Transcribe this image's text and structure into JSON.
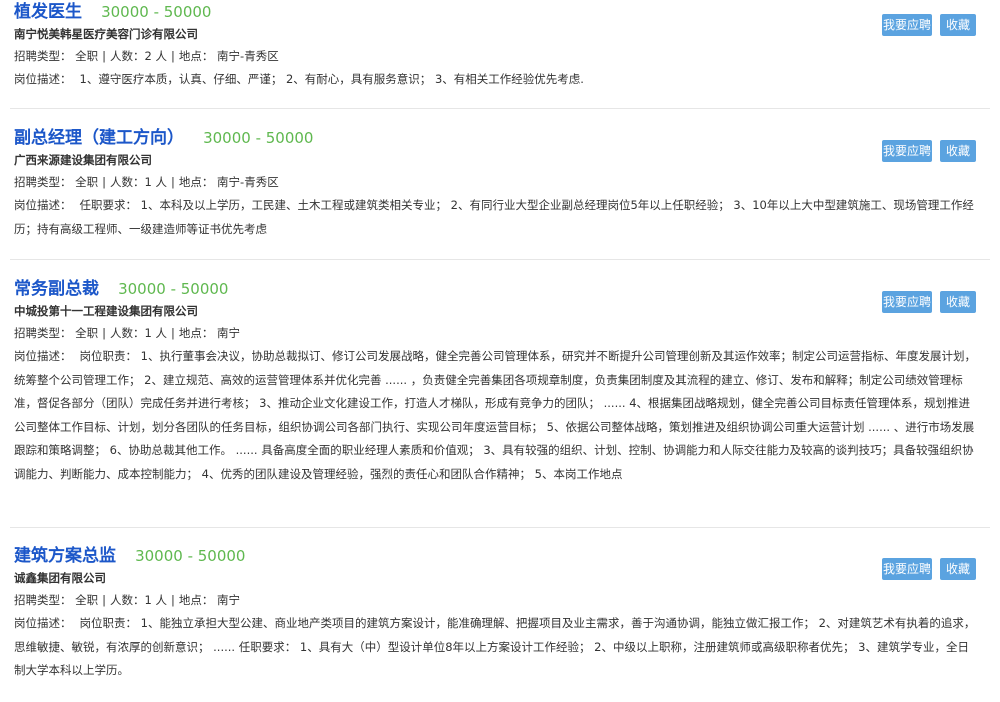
{
  "labels": {
    "type": "招聘类型：",
    "count": "人数：",
    "location": "地点：",
    "description": "岗位描述：",
    "apply_button": "我要应聘",
    "favorite_button": "收藏"
  },
  "jobs": [
    {
      "title": "植发医生",
      "salary": "30000 - 50000",
      "company": "南宁悦美韩星医疗美容门诊有限公司",
      "type": "全职",
      "count": "2 人",
      "location": "南宁-青秀区",
      "description": "1、遵守医疗本质，认真、仔细、严谨； 2、有耐心，具有服务意识； 3、有相关工作经验优先考虑."
    },
    {
      "title": "副总经理（建工方向）",
      "salary": "30000 - 50000",
      "company": "广西来源建设集团有限公司",
      "type": "全职",
      "count": "1 人",
      "location": "南宁-青秀区",
      "description": "任职要求： 1、本科及以上学历，工民建、土木工程或建筑类相关专业； 2、有同行业大型企业副总经理岗位5年以上任职经验； 3、10年以上大中型建筑施工、现场管理工作经历；持有高级工程师、一级建造师等证书优先考虑"
    },
    {
      "title": "常务副总裁",
      "salary": "30000 - 50000",
      "company": "中城投第十一工程建设集团有限公司",
      "type": "全职",
      "count": "1 人",
      "location": "南宁",
      "description": "岗位职责： 1、执行董事会决议，协助总裁拟订、修订公司发展战略，健全完善公司管理体系，研究并不断提升公司管理创新及其运作效率；制定公司运营指标、年度发展计划，统筹整个公司管理工作； 2、建立规范、高效的运营管理体系并优化完善 ...... ，负责健全完善集团各项规章制度，负责集团制度及其流程的建立、修订、发布和解释；制定公司绩效管理标准，督促各部分（团队）完成任务并进行考核； 3、推动企业文化建设工作，打造人才梯队，形成有竞争力的团队； ...... 4、根据集团战略规划，健全完善公司目标责任管理体系，规划推进公司整体工作目标、计划，划分各团队的任务目标，组织协调公司各部门执行、实现公司年度运营目标； 5、依据公司整体战略，策划推进及组织协调公司重大运营计划 ...... 、进行市场发展跟踪和策略调整； 6、协助总裁其他工作。 ...... 具备高度全面的职业经理人素质和价值观； 3、具有较强的组织、计划、控制、协调能力和人际交往能力及较高的谈判技巧；具备较强组织协调能力、判断能力、成本控制能力； 4、优秀的团队建设及管理经验，强烈的责任心和团队合作精神； 5、本岗工作地点"
    },
    {
      "title": "建筑方案总监",
      "salary": "30000 - 50000",
      "company": "诚鑫集团有限公司",
      "type": "全职",
      "count": "1 人",
      "location": "南宁",
      "description": "岗位职责： 1、能独立承担大型公建、商业地产类项目的建筑方案设计，能准确理解、把握项目及业主需求，善于沟通协调，能独立做汇报工作； 2、对建筑艺术有执着的追求，思维敏捷、敏锐，有浓厚的创新意识； ...... 任职要求： 1、具有大（中）型设计单位8年以上方案设计工作经验； 2、中级以上职称，注册建筑师或高级职称者优先； 3、建筑学专业，全日制大学本科以上学历。"
    }
  ]
}
